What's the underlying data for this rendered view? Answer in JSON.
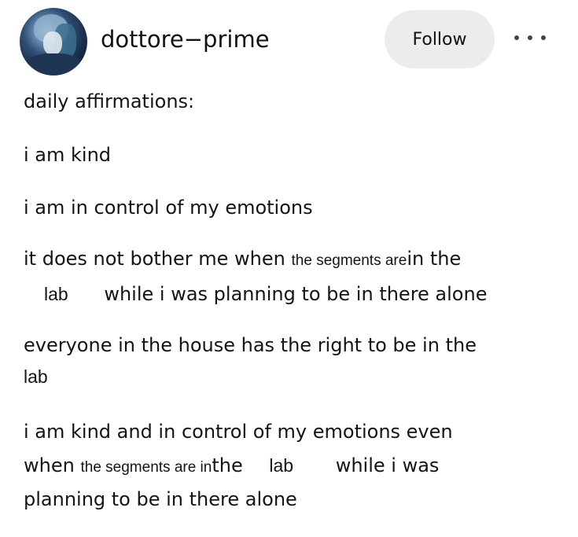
{
  "post": {
    "username": "dottore−prime",
    "follow_label": "Follow",
    "lines": [
      "daily affirmations:",
      "i am kind",
      "i am in control of my emotions",
      "it does not bother me when",
      "the segments are",
      "in the",
      "lab",
      "while i was planning to be in there alone",
      "everyone in the house has the right to be in the",
      "lab",
      "i am kind and in control of my emotions even",
      "when",
      "the segments are in",
      "the",
      "lab",
      "while i was",
      "planning to be in there alone"
    ]
  },
  "icons": {
    "avatar": "avatar-image",
    "more": "more-options-icon"
  }
}
